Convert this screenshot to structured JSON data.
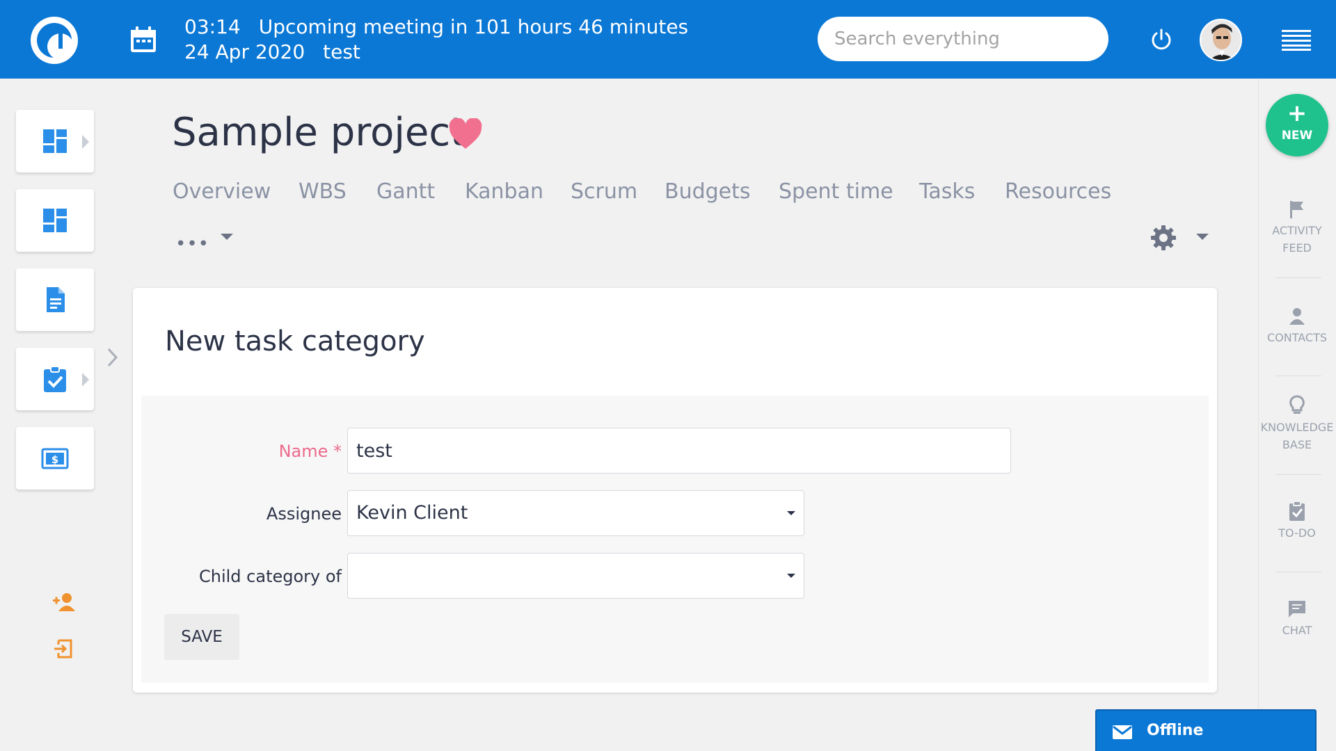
{
  "topbar": {
    "time": "03:14",
    "meeting": "Upcoming meeting in 101 hours 46 minutes",
    "date": "24 Apr 2020",
    "user": "test",
    "search_placeholder": "Search everything"
  },
  "project": {
    "title": "Sample project",
    "tabs": [
      "Overview",
      "WBS",
      "Gantt",
      "Kanban",
      "Scrum",
      "Budgets",
      "Spent time",
      "Tasks",
      "Resources"
    ],
    "more": "•••"
  },
  "card": {
    "title": "New task category",
    "fields": {
      "name_label": "Name *",
      "name_value": "test",
      "assignee_label": "Assignee",
      "assignee_value": "Kevin Client",
      "child_label": "Child category of",
      "child_value": ""
    },
    "save_label": "SAVE"
  },
  "right_rail": {
    "new_label": "NEW",
    "activity_line1": "ACTIVITY",
    "activity_line2": "FEED",
    "contacts": "CONTACTS",
    "kb_line1": "KNOWLEDGE",
    "kb_line2": "BASE",
    "todo": "TO-DO",
    "chat": "CHAT"
  },
  "chat_bar": {
    "status": "Offline"
  },
  "colors": {
    "primary": "#0b78d6",
    "new_button": "#1fc28c",
    "heart": "#f2708f",
    "required_label": "#ec6a8c",
    "orange_icons": "#f0922f"
  },
  "icons": {
    "logo": "easy-logo-icon",
    "calendar": "calendar-icon",
    "power": "power-icon",
    "menu": "hamburger-menu-icon",
    "heart": "heart-icon",
    "gear": "gear-icon"
  }
}
